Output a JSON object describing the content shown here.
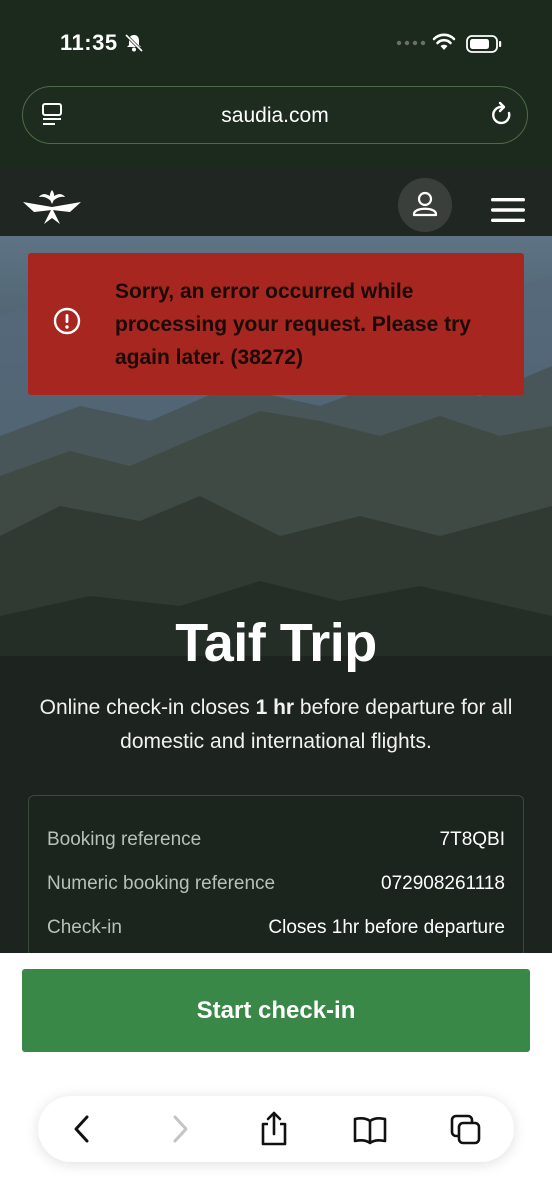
{
  "status_bar": {
    "time": "11:35"
  },
  "browser": {
    "url": "saudia.com"
  },
  "error": {
    "message": "Sorry, an error occurred while processing your request. Please try again later. (38272)"
  },
  "trip": {
    "title": "Taif Trip",
    "subtitle_pre": "Online check-in closes ",
    "subtitle_bold": "1 hr",
    "subtitle_post": " before departure for all domestic and international flights."
  },
  "details": [
    {
      "label": "Booking reference",
      "value": "7T8QBI"
    },
    {
      "label": "Numeric booking reference",
      "value": "072908261118"
    },
    {
      "label": "Check-in",
      "value": "Closes 1hr before departure"
    }
  ],
  "actions": {
    "start_checkin": "Start check-in"
  },
  "toolbar_icons": [
    "back-icon",
    "forward-icon",
    "share-icon",
    "bookmarks-icon",
    "tabs-icon"
  ],
  "colors": {
    "background": "#1c2a1e",
    "error": "#a7261f",
    "primary_button": "#3a8847",
    "header": "#202723"
  }
}
